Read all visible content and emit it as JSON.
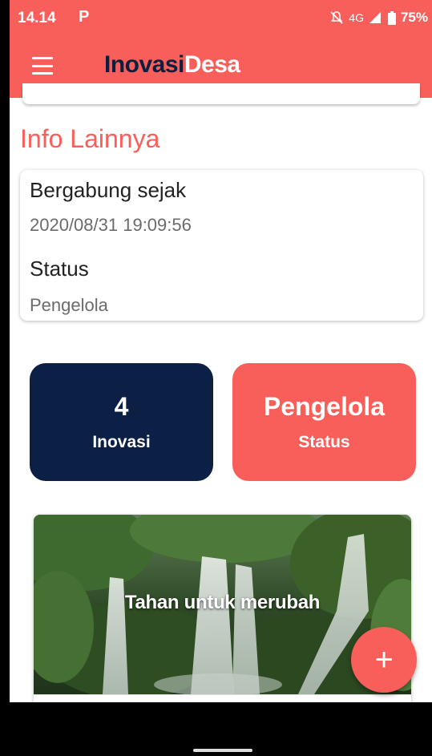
{
  "status_bar": {
    "time": "14.14",
    "notification": "P",
    "network": "4G",
    "battery": "75%",
    "icons": [
      "mute-bell-icon",
      "signal-icon",
      "battery-icon"
    ]
  },
  "app_bar": {
    "title_part1": "Inovasi",
    "title_part2": "Desa",
    "menu_icon": "hamburger-menu-icon"
  },
  "info_section": {
    "title": "Info Lainnya",
    "joined_label": "Bergabung sejak",
    "joined_value": "2020/08/31 19:09:56",
    "status_label": "Status",
    "status_value": "Pengelola"
  },
  "stats": [
    {
      "value": "4",
      "label": "Inovasi"
    },
    {
      "value": "Pengelola",
      "label": "Status"
    }
  ],
  "photo_card": {
    "caption": "Tahan untuk merubah"
  },
  "fab": {
    "icon": "plus-icon",
    "label": "+"
  },
  "colors": {
    "primary": "#f95f5a",
    "navy": "#0c2045",
    "title_dark": "#0c1f3f"
  }
}
